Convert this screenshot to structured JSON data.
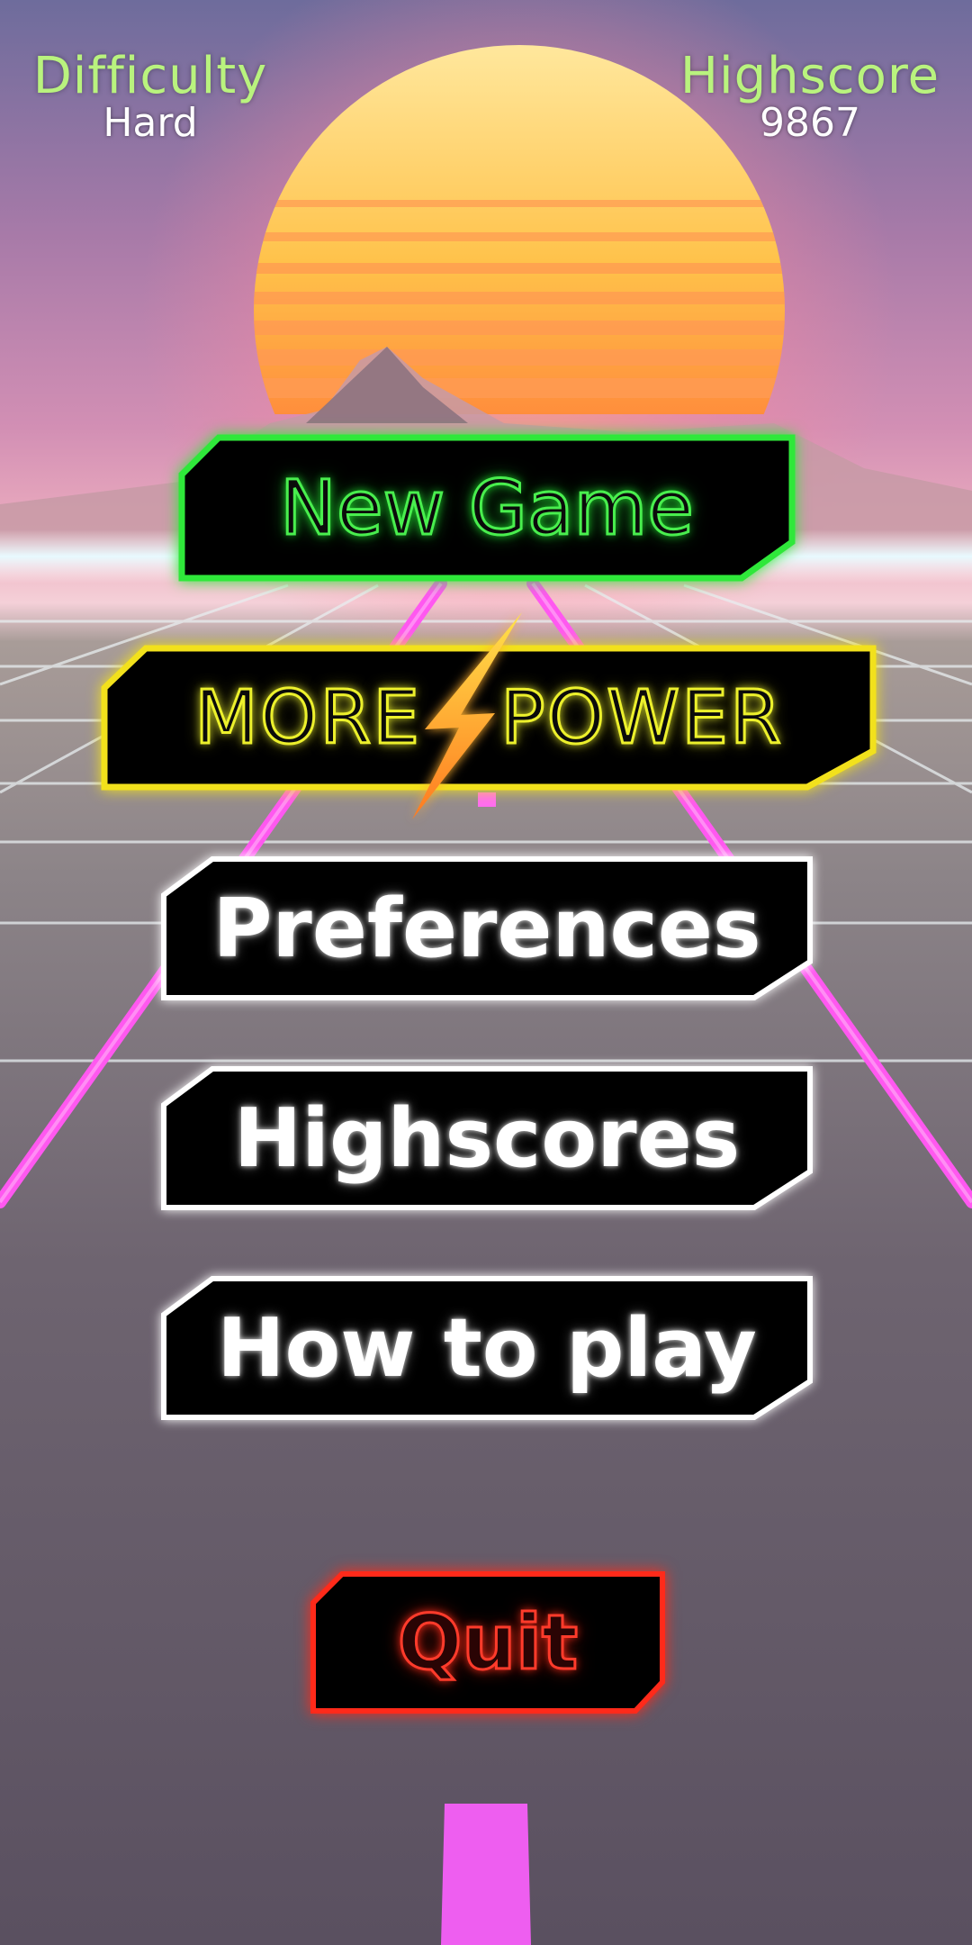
{
  "hud": {
    "difficulty_label": "Difficulty",
    "difficulty_value": "Hard",
    "highscore_label": "Highscore",
    "highscore_value": "9867"
  },
  "menu": {
    "new_game": "New Game",
    "more_power_1": "MORE",
    "more_power_2": "POWER",
    "preferences": "Preferences",
    "highscores": "Highscores",
    "how_to_play": "How to play",
    "quit": "Quit"
  },
  "colors": {
    "new_game": "#2fe83a",
    "more_power": "#f2e11c",
    "default_button": "#ffffff",
    "quit": "#ff2a1a",
    "hud_label": "#b9f37e",
    "sun_top": "#ffe27a",
    "sun_bottom": "#ff9a3a",
    "road_lines": "#ff5cf0"
  },
  "icons": {
    "bolt": "lightning-bolt-icon"
  }
}
